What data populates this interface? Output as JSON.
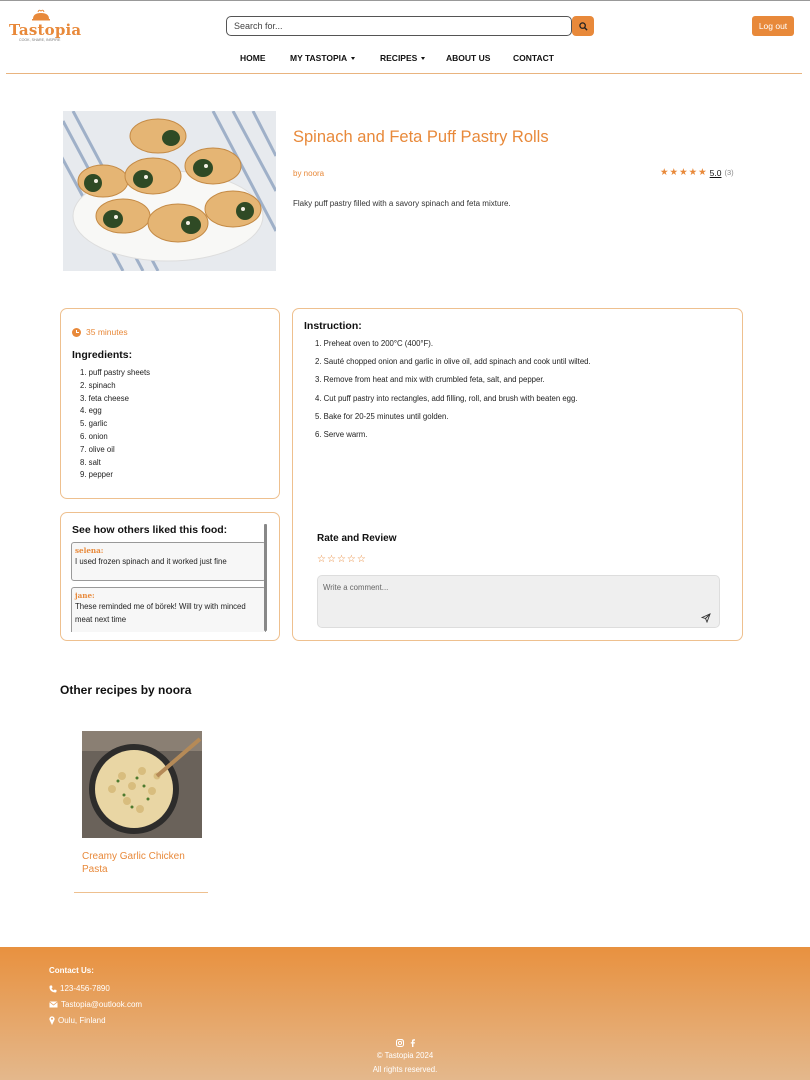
{
  "header": {
    "logo_text": "Tastopia",
    "logo_tagline": "COOK, SHARE, INSPIRE",
    "search_placeholder": "Search for...",
    "logout_label": "Log out"
  },
  "nav": {
    "home": "HOME",
    "my_tastopia": "MY TASTOPIA",
    "recipes": "RECIPES",
    "about": "ABOUT US",
    "contact": "CONTACT"
  },
  "recipe": {
    "title": "Spinach and Feta Puff Pastry Rolls",
    "author": "by noora",
    "rating_value": "5.0",
    "rating_count": "(3)",
    "stars": 5,
    "description": "Flaky puff pastry filled with a savory spinach and feta mixture.",
    "time": "35 minutes",
    "ingredients_heading": "Ingredients:",
    "ingredients": [
      "1. puff pastry sheets",
      "2. spinach",
      "3. feta cheese",
      "4. egg",
      "5. garlic",
      "6. onion",
      "7. olive oil",
      "8. salt",
      "9. pepper"
    ],
    "instruction_heading": "Instruction:",
    "instructions": [
      "1. Preheat oven to 200°C (400°F).",
      "2. Sauté chopped onion and garlic in olive oil, add spinach and cook until wilted.",
      "3. Remove from heat and mix with crumbled feta, salt, and pepper.",
      "4. Cut puff pastry into rectangles, add filling, roll, and brush with beaten egg.",
      "5. Bake for 20-25 minutes until golden.",
      "6. Serve warm."
    ]
  },
  "reviews": {
    "heading": "See how others liked this food:",
    "items": [
      {
        "author": "selena:",
        "text": "I used frozen spinach and it worked just fine"
      },
      {
        "author": "jane:",
        "text": "These reminded me of börek! Will try with minced meat next time"
      }
    ]
  },
  "rate": {
    "heading": "Rate and Review",
    "comment_placeholder": "Write a comment..."
  },
  "other": {
    "heading": "Other recipes by noora",
    "recipes": [
      {
        "name": "Creamy Garlic Chicken Pasta"
      }
    ]
  },
  "footer": {
    "contact_heading": "Contact Us:",
    "phone": "123-456-7890",
    "email": "Tastopia@outlook.com",
    "location": "Oulu, Finland",
    "copyright": "© Tastopia 2024",
    "rights": "All rights reserved."
  },
  "colors": {
    "accent": "#e8893a",
    "card_border": "#eec08f"
  }
}
